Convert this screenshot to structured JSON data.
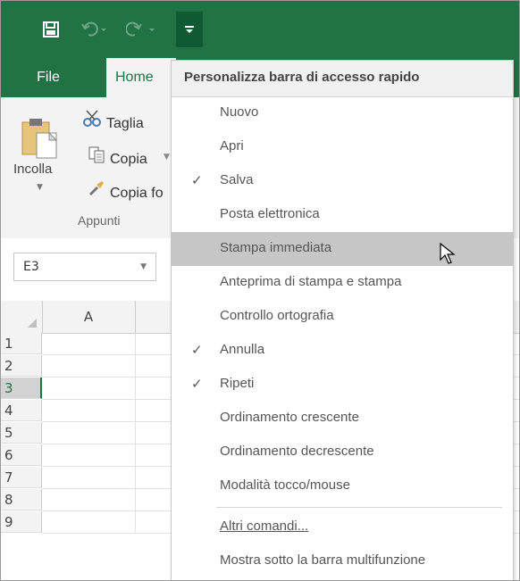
{
  "colors": {
    "excel_green": "#217346",
    "ribbon_bg": "#f3f3f3",
    "menu_hover": "#c6c6c6"
  },
  "titlebar": {
    "save_icon": "save-icon",
    "undo_icon": "undo-icon",
    "redo_icon": "redo-icon",
    "customize_icon": "customize-qat-icon"
  },
  "tabs": [
    {
      "label": "File"
    },
    {
      "label": "Home"
    }
  ],
  "ribbon": {
    "paste_label": "Incolla",
    "cut_label": "Taglia",
    "copy_label": "Copia",
    "format_painter_label": "Copia fo",
    "group_label": "Appunti"
  },
  "namebox": {
    "value": "E3"
  },
  "grid": {
    "column_headers": [
      "A"
    ],
    "row_headers": [
      "1",
      "2",
      "3",
      "4",
      "5",
      "6",
      "7",
      "8",
      "9"
    ],
    "active_row": "3"
  },
  "menu": {
    "title": "Personalizza barra di accesso rapido",
    "items": [
      {
        "label": "Nuovo",
        "checked": false
      },
      {
        "label": "Apri",
        "checked": false
      },
      {
        "label": "Salva",
        "checked": true
      },
      {
        "label": "Posta elettronica",
        "checked": false
      },
      {
        "label": "Stampa immediata",
        "checked": false,
        "hovered": true
      },
      {
        "label": "Anteprima di stampa e stampa",
        "checked": false
      },
      {
        "label": "Controllo ortografia",
        "checked": false
      },
      {
        "label": "Annulla",
        "checked": true
      },
      {
        "label": "Ripeti",
        "checked": true
      },
      {
        "label": "Ordinamento crescente",
        "checked": false
      },
      {
        "label": "Ordinamento decrescente",
        "checked": false
      },
      {
        "label": "Modalità tocco/mouse",
        "checked": false
      },
      {
        "label": "Altri comandi...",
        "checked": false
      },
      {
        "label": "Mostra sotto la barra multifunzione",
        "checked": false
      }
    ],
    "check_glyph": "✓"
  }
}
